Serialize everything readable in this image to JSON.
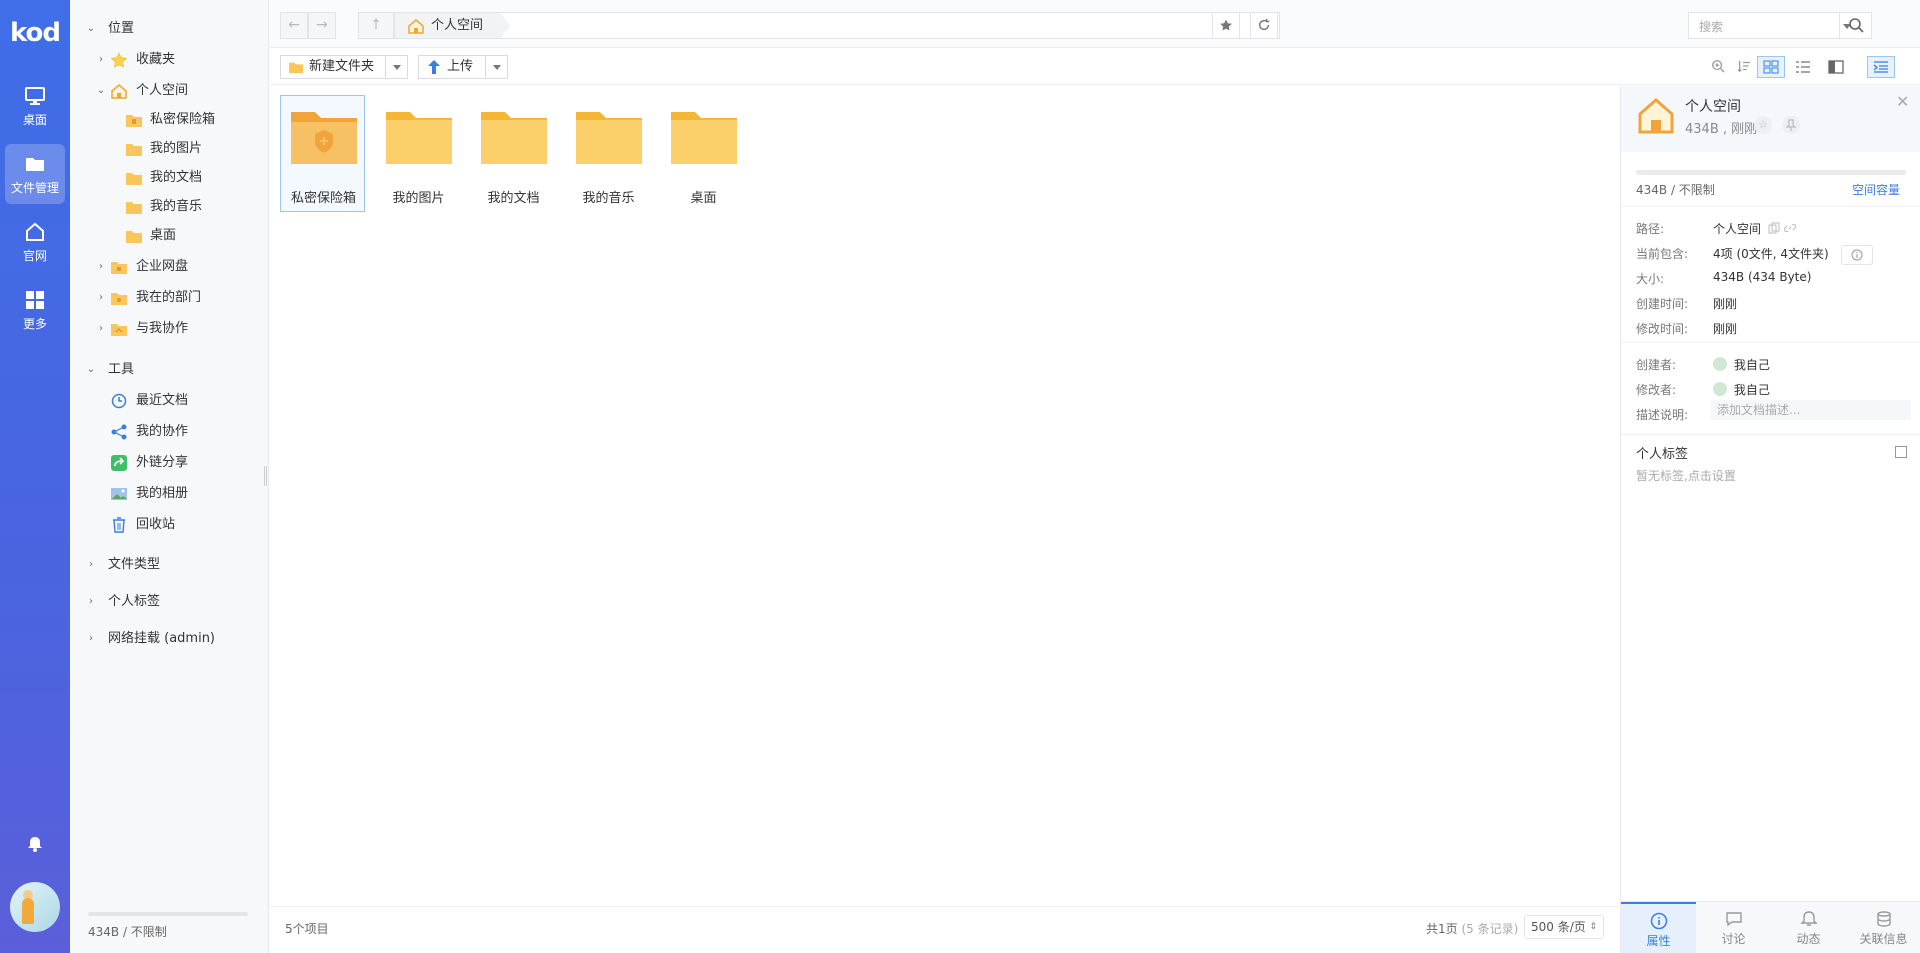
{
  "app": {
    "logo_text": "kod"
  },
  "rail": {
    "items": [
      {
        "label": "桌面",
        "icon": "monitor-icon"
      },
      {
        "label": "文件管理",
        "icon": "folder-icon",
        "active": true
      },
      {
        "label": "官网",
        "icon": "home-icon"
      },
      {
        "label": "更多",
        "icon": "grid-icon"
      }
    ]
  },
  "tree": {
    "location_label": "位置",
    "favorites_label": "收藏夹",
    "personal_label": "个人空间",
    "children": [
      "私密保险箱",
      "我的图片",
      "我的文档",
      "我的音乐",
      "桌面"
    ],
    "enterprise_label": "企业网盘",
    "department_label": "我在的部门",
    "collab_label": "与我协作",
    "tools_label": "工具",
    "tools": [
      "最近文档",
      "我的协作",
      "外链分享",
      "我的相册",
      "回收站"
    ],
    "filetype_label": "文件类型",
    "personal_tags_label": "个人标签",
    "network_mount_label": "网络挂载 (admin)",
    "quota_text": "434B / 不限制"
  },
  "topbar": {
    "breadcrumb": "个人空间",
    "search_placeholder": "搜索"
  },
  "toolbar": {
    "new_folder_label": "新建文件夹",
    "upload_label": "上传"
  },
  "files": {
    "items": [
      {
        "name": "私密保险箱",
        "type": "vault",
        "selected": true
      },
      {
        "name": "我的图片",
        "type": "folder"
      },
      {
        "name": "我的文档",
        "type": "folder"
      },
      {
        "name": "我的音乐",
        "type": "folder"
      },
      {
        "name": "桌面",
        "type": "folder"
      }
    ],
    "count_text": "5个项目",
    "page_prefix": "共1页",
    "page_records": "(5 条记录)",
    "per_page": "500 条/页"
  },
  "panel": {
    "title": "个人空间",
    "subtitle": "434B , 刚刚",
    "usage_text": "434B / 不限制",
    "capacity_link": "空间容量",
    "props": {
      "path_k": "路径:",
      "path_v": "个人空间",
      "contains_k": "当前包含:",
      "contains_v": "4项 (0文件, 4文件夹)",
      "size_k": "大小:",
      "size_v": "434B (434 Byte)",
      "created_k": "创建时间:",
      "created_v": "刚刚",
      "modified_k": "修改时间:",
      "modified_v": "刚刚",
      "creator_k": "创建者:",
      "creator_v": "我自己",
      "modifier_k": "修改者:",
      "modifier_v": "我自己",
      "desc_k": "描述说明:",
      "desc_placeholder": "添加文档描述..."
    },
    "tags_title": "个人标签",
    "tags_empty": "暂无标签,点击设置",
    "tabs": [
      "属性",
      "讨论",
      "动态",
      "关联信息"
    ]
  },
  "colors": {
    "accent": "#3a7ee0",
    "rail": "#4a64e0",
    "folder": "#f8c65a"
  }
}
